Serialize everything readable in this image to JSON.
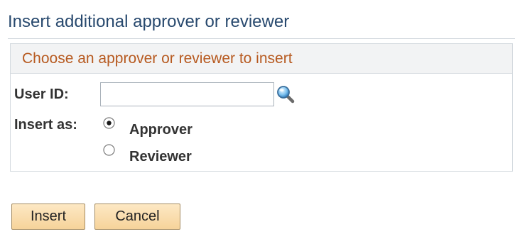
{
  "page": {
    "title": "Insert additional approver or reviewer"
  },
  "group": {
    "header": "Choose an approver or reviewer to insert"
  },
  "user_id": {
    "label": "User ID:",
    "value": "",
    "lookup_icon": "magnifier-lookup-icon"
  },
  "insert_as": {
    "label": "Insert as:",
    "options": [
      {
        "label": "Approver",
        "selected": true
      },
      {
        "label": "Reviewer",
        "selected": false
      }
    ]
  },
  "buttons": {
    "insert_label": "Insert",
    "cancel_label": "Cancel"
  },
  "colors": {
    "title": "#28496e",
    "group_header_text": "#b75a20",
    "button_fill": "#f6d39a"
  }
}
